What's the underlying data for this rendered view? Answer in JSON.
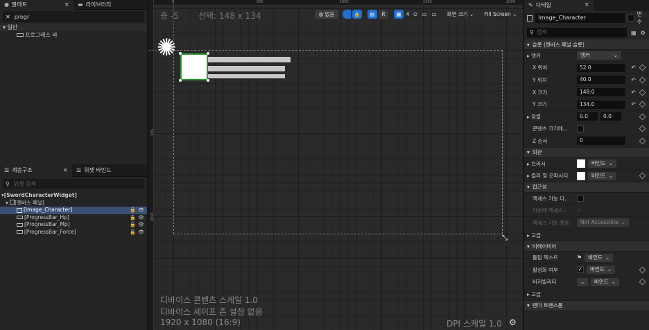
{
  "palette": {
    "tab": "팔레트",
    "tab2": "라이브러리",
    "search_value": "progr",
    "category": "일반",
    "item": "프로그레스 바"
  },
  "hierarchy": {
    "tab": "계층구조",
    "tab2": "위젯 바인드",
    "search_placeholder": "위젯 검색",
    "items": [
      "[SwordCharacterWidget]",
      "[캔버스 패널]",
      "[Image_Character]",
      "[ProgressBar_Hp]",
      "[ProgressBar_Mp]",
      "[ProgressBar_Force]"
    ]
  },
  "viewport": {
    "zoom": "줌 -5",
    "selection": "선택: 148 x 134",
    "none_label": "없음",
    "r_label": "R",
    "grid_num": "4",
    "screen_size": "화면 크기",
    "fill_screen": "Fill Screen",
    "variant": "변수",
    "ruler_top": [
      "0",
      "500",
      "1000",
      "1500",
      "2000"
    ],
    "ruler_left": [
      "500",
      "1000"
    ],
    "content_scale": "디바이스 콘텐츠 스케일 1.0",
    "safe_zone": "디바이스 세이프 존 설정 없음",
    "resolution": "1920 x 1080 (16:9)",
    "dpi": "DPI 스케일 1.0"
  },
  "details": {
    "tab": "디테일",
    "name": "Image_Character",
    "variable_label": "변수",
    "search_placeholder": "검색",
    "slot_section": "슬롯 (캔버스 패널 슬롯)",
    "anchor": {
      "label": "앵커",
      "value": "앵커"
    },
    "rows": [
      {
        "label": "X 위치",
        "value": "52.0"
      },
      {
        "label": "Y 위치",
        "value": "40.0"
      },
      {
        "label": "X 크기",
        "value": "148.0"
      },
      {
        "label": "Y 크기",
        "value": "134.0"
      }
    ],
    "alignment": {
      "label": "정렬",
      "x": "0.0",
      "y": "0.0"
    },
    "size_to_content": "콘텐츠 크기에...",
    "zorder": {
      "label": "Z 순서",
      "value": "0"
    },
    "appearance": "외관",
    "brush": "브러시",
    "color_opacity": "컬러 및 오파시티",
    "bind": "바인드",
    "accessibility": "접근성",
    "access_enable": "액세스 가능 다...",
    "override_access": "자손에 액세스...",
    "access_behavior": "액세스 가능 행동",
    "not_accessible": "Not Accessible",
    "advanced": "고급",
    "behavior": "비헤이비어",
    "tooltip": "툴팁 텍스트",
    "is_enabled": "활성화 여부",
    "visibility": "비저빌리티",
    "advanced2": "고급",
    "render_transform": "렌더 트랜스폼"
  }
}
